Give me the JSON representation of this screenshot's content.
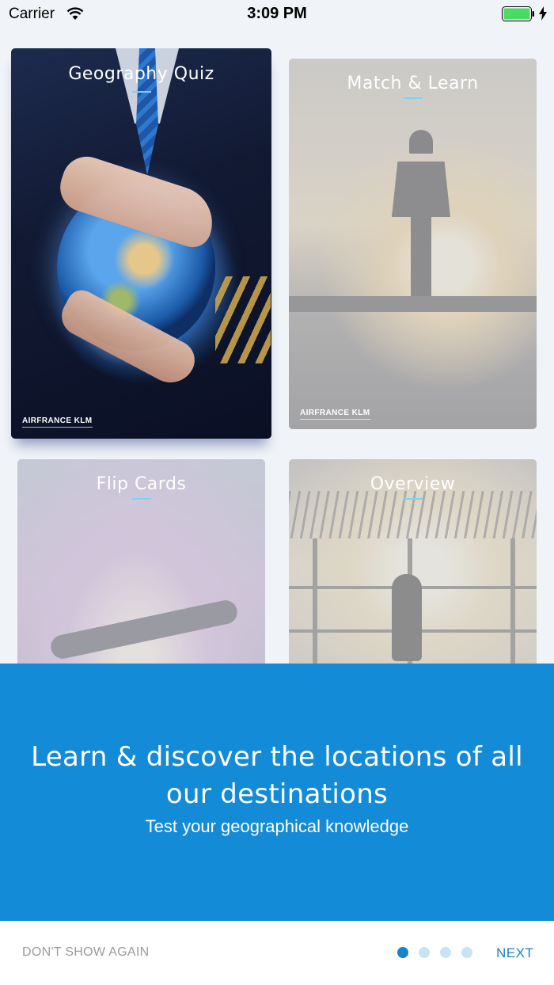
{
  "status_bar": {
    "carrier": "Carrier",
    "time": "3:09 PM",
    "battery_color": "#4cd964"
  },
  "cards": [
    {
      "title": "Geography Quiz",
      "brand": "AIRFRANCE KLM",
      "selected": true
    },
    {
      "title": "Match & Learn",
      "brand": "AIRFRANCE KLM",
      "selected": false
    },
    {
      "title": "Flip Cards",
      "selected": false
    },
    {
      "title": "Overview",
      "selected": false
    }
  ],
  "panel": {
    "title": "Learn & discover the locations of all our destinations",
    "subtitle": "Test your geographical knowledge",
    "background": "#138bd6"
  },
  "footer": {
    "dont_show_label": "DON'T SHOW AGAIN",
    "next_label": "NEXT",
    "page_count": 4,
    "current_page": 1,
    "accent": "#1a82c9"
  }
}
